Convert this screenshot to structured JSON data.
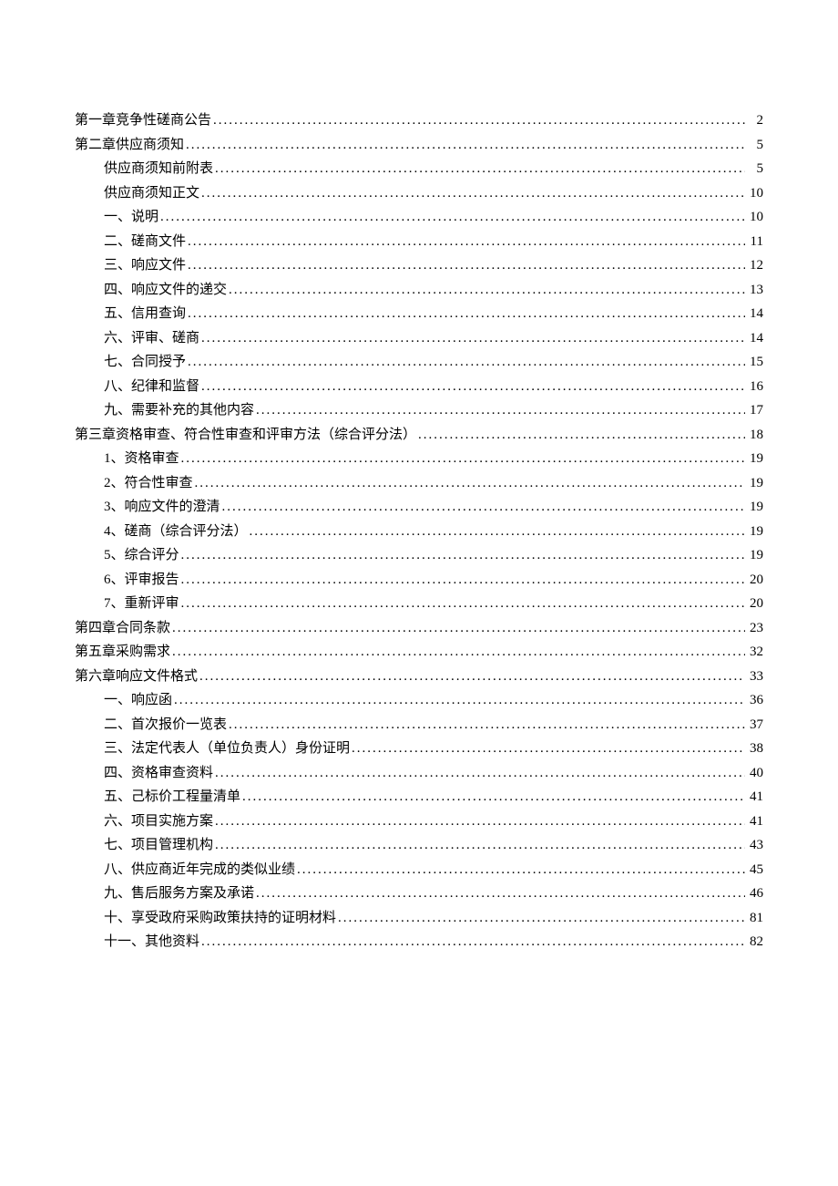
{
  "toc": [
    {
      "level": 0,
      "title": "第一章竞争性磋商公告",
      "page": "2"
    },
    {
      "level": 0,
      "title": "第二章供应商须知",
      "page": "5"
    },
    {
      "level": 1,
      "title": "供应商须知前附表",
      "page": "5"
    },
    {
      "level": 1,
      "title": "供应商须知正文",
      "page": "10"
    },
    {
      "level": 1,
      "title": "一、说明",
      "page": "10"
    },
    {
      "level": 1,
      "title": "二、磋商文件",
      "page": "11"
    },
    {
      "level": 1,
      "title": "三、响应文件",
      "page": "12"
    },
    {
      "level": 1,
      "title": "四、响应文件的递交",
      "page": "13"
    },
    {
      "level": 1,
      "title": "五、信用查询",
      "page": "14"
    },
    {
      "level": 1,
      "title": "六、评审、磋商",
      "page": "14"
    },
    {
      "level": 1,
      "title": "七、合同授予",
      "page": "15"
    },
    {
      "level": 1,
      "title": "八、纪律和监督",
      "page": "16"
    },
    {
      "level": 1,
      "title": "九、需要补充的其他内容",
      "page": "17"
    },
    {
      "level": 0,
      "title": "第三章资格审查、符合性审查和评审方法（综合评分法）",
      "page": "18"
    },
    {
      "level": 1,
      "title": "1、资格审查",
      "page": "19"
    },
    {
      "level": 1,
      "title": "2、符合性审查",
      "page": "19"
    },
    {
      "level": 1,
      "title": "3、响应文件的澄清",
      "page": "19"
    },
    {
      "level": 1,
      "title": "4、磋商（综合评分法）",
      "page": "19"
    },
    {
      "level": 1,
      "title": "5、综合评分",
      "page": "19"
    },
    {
      "level": 1,
      "title": "6、评审报告",
      "page": "20"
    },
    {
      "level": 1,
      "title": "7、重新评审",
      "page": "20"
    },
    {
      "level": 0,
      "title": "第四章合同条款",
      "page": "23"
    },
    {
      "level": 0,
      "title": "第五章采购需求",
      "page": "32"
    },
    {
      "level": 0,
      "title": "第六章响应文件格式",
      "page": "33"
    },
    {
      "level": 1,
      "title": "一、响应函",
      "page": "36"
    },
    {
      "level": 1,
      "title": "二、首次报价一览表",
      "page": "37"
    },
    {
      "level": 1,
      "title": "三、法定代表人（单位负责人）身份证明",
      "page": "38"
    },
    {
      "level": 1,
      "title": "四、资格审查资料",
      "page": "40"
    },
    {
      "level": 1,
      "title": "五、己标价工程量清单",
      "page": "41"
    },
    {
      "level": 1,
      "title": "六、项目实施方案",
      "page": "41"
    },
    {
      "level": 1,
      "title": "七、项目管理机构",
      "page": "43"
    },
    {
      "level": 1,
      "title": "八、供应商近年完成的类似业绩",
      "page": "45"
    },
    {
      "level": 1,
      "title": "九、售后服务方案及承诺",
      "page": "46"
    },
    {
      "level": 1,
      "title": "十、享受政府采购政策扶持的证明材料",
      "page": "81"
    },
    {
      "level": 1,
      "title": "十一、其他资料",
      "page": "82"
    }
  ]
}
